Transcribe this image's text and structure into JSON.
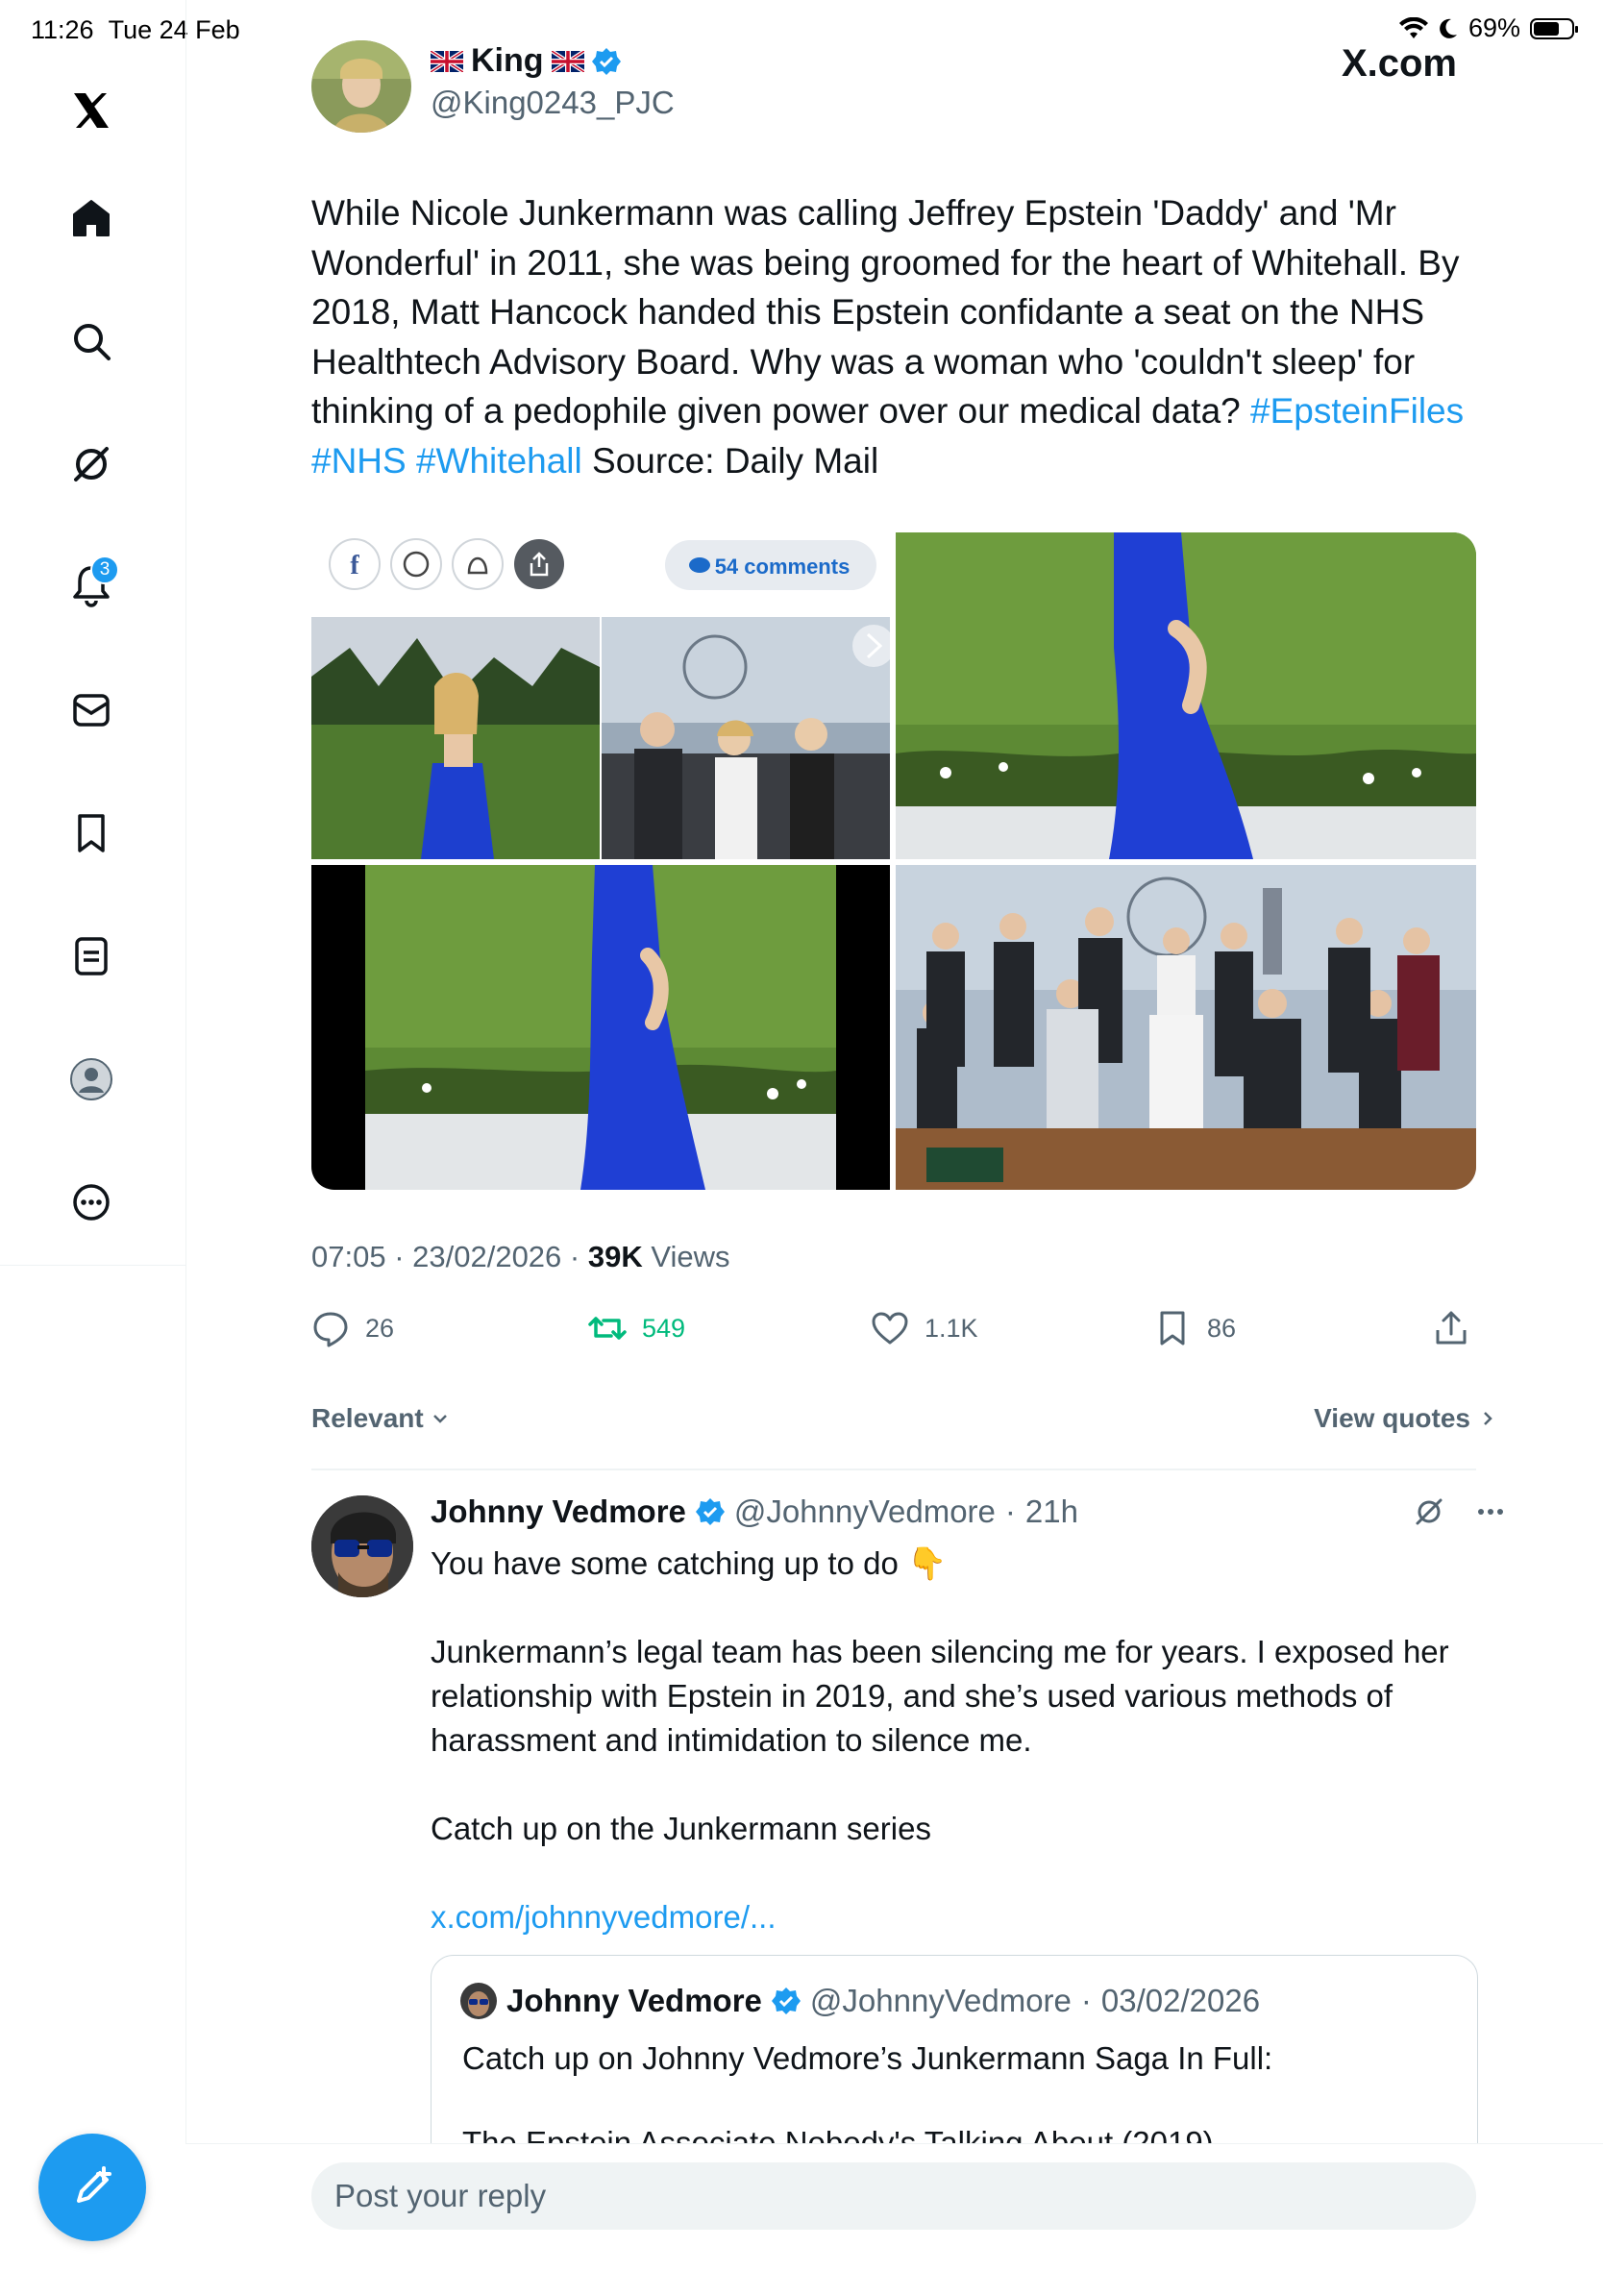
{
  "status_bar": {
    "time": "11:26",
    "date": "Tue 24 Feb",
    "battery": "69%",
    "battery_level": 0.69
  },
  "site_label": "X.com",
  "sidebar": {
    "items": [
      {
        "icon": "x-logo-icon"
      },
      {
        "icon": "home-icon"
      },
      {
        "icon": "search-icon"
      },
      {
        "icon": "grok-icon"
      },
      {
        "icon": "notifications-icon",
        "badge": "3"
      },
      {
        "icon": "messages-icon"
      },
      {
        "icon": "bookmarks-icon"
      },
      {
        "icon": "lists-icon"
      },
      {
        "icon": "profile-icon"
      },
      {
        "icon": "more-icon"
      }
    ]
  },
  "post": {
    "author_name": "King",
    "author_handle": "@King0243_PJC",
    "text": "While Nicole Junkermann was calling Jeffrey Epstein 'Daddy' and 'Mr Wonderful' in 2011, she was being groomed for the heart of Whitehall. By 2018, Matt Hancock handed this Epstein confidante a seat on the NHS Healthtech Advisory Board. Why was a woman who 'couldn't sleep' for thinking of a pedophile given power over our medical data?",
    "hashtags": [
      "#EpsteinFiles",
      "#NHS",
      "#Whitehall"
    ],
    "source": "Source: Daily Mail",
    "media": {
      "comments_label": "54 comments"
    },
    "time": "07:05",
    "date": "23/02/2026",
    "views_count": "39K",
    "views_label": "Views",
    "stats": {
      "replies": "26",
      "reposts": "549",
      "likes": "1.1K",
      "bookmarks": "86"
    }
  },
  "sort": {
    "relevant_label": "Relevant",
    "view_quotes_label": "View quotes"
  },
  "reply": {
    "name": "Johnny Vedmore",
    "handle": "@JohnnyVedmore",
    "age": "21h",
    "line1": "You have some catching up to do 👇",
    "para2": "Junkermann’s legal team has been silencing me for years. I exposed her relationship with Epstein in 2019, and she’s used various methods of harassment and intimidation to silence me.",
    "para3": "Catch up on the Junkermann series",
    "link": "x.com/johnnyvedmore/...",
    "quote": {
      "name": "Johnny Vedmore",
      "handle": "@JohnnyVedmore",
      "date": "03/02/2026",
      "text": "Catch up on Johnny Vedmore’s Junkermann Saga In Full:",
      "cut_line": "The Epstein Associate Nobody's Talking About (2019)"
    }
  },
  "composer": {
    "placeholder": "Post your reply"
  },
  "colors": {
    "accent": "#1d9bf0",
    "repost": "#00ba7c",
    "muted": "#536471"
  }
}
